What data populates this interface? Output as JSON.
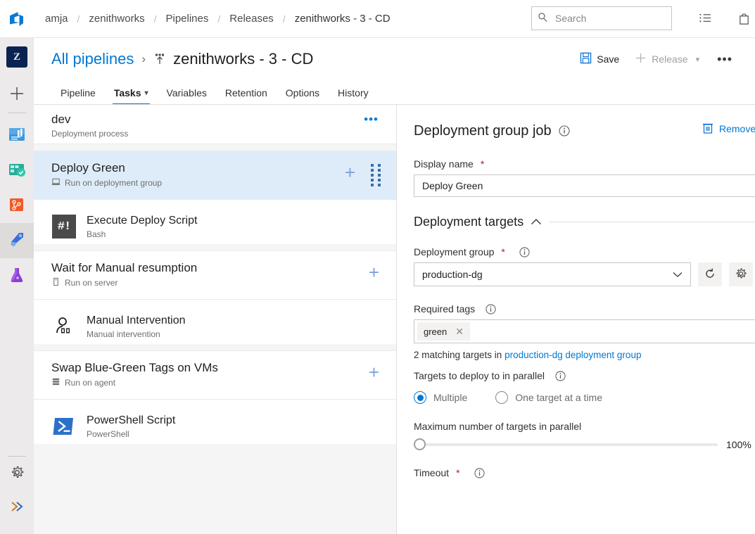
{
  "topbar": {
    "breadcrumb": [
      "amja",
      "zenithworks",
      "Pipelines",
      "Releases",
      "zenithworks - 3 - CD"
    ],
    "separator": "/",
    "search_placeholder": "Search",
    "icons": {
      "search": "search-icon",
      "work_items": "list-icon",
      "marketplace": "shopping-bag-icon"
    }
  },
  "header": {
    "all_pipelines": "All pipelines",
    "chevron": "›",
    "title": "zenithworks - 3 - CD",
    "save_label": "Save",
    "release_label": "Release",
    "ellipsis": "…",
    "tabs": [
      {
        "label": "Pipeline",
        "active": false,
        "has_chevron": false
      },
      {
        "label": "Tasks",
        "active": true,
        "has_chevron": true
      },
      {
        "label": "Variables",
        "active": false,
        "has_chevron": false
      },
      {
        "label": "Retention",
        "active": false,
        "has_chevron": false
      },
      {
        "label": "Options",
        "active": false,
        "has_chevron": false
      },
      {
        "label": "History",
        "active": false,
        "has_chevron": false
      }
    ]
  },
  "tasklist": {
    "process": {
      "title": "dev",
      "subtitle": "Deployment process",
      "ellipsis": "…"
    },
    "groups": [
      {
        "phase": {
          "name": "Deploy Green",
          "sub": "Run on deployment group",
          "selected": true,
          "icon": "deployment-group-icon"
        },
        "tasks": [
          {
            "name": "Execute Deploy Script",
            "sub": "Bash",
            "icon": "bash-icon"
          }
        ]
      },
      {
        "phase": {
          "name": "Wait for Manual resumption",
          "sub": "Run on server",
          "selected": false,
          "icon": "server-icon"
        },
        "tasks": [
          {
            "name": "Manual Intervention",
            "sub": "Manual intervention",
            "icon": "manual-intervention-icon"
          }
        ]
      },
      {
        "phase": {
          "name": "Swap Blue-Green Tags on VMs",
          "sub": "Run on agent",
          "selected": false,
          "icon": "agent-icon"
        },
        "tasks": [
          {
            "name": "PowerShell Script",
            "sub": "PowerShell",
            "icon": "powershell-icon"
          }
        ]
      }
    ]
  },
  "details": {
    "title": "Deployment group job",
    "remove_label": "Remove",
    "display_name": {
      "label": "Display name",
      "required": true,
      "value": "Deploy Green"
    },
    "section": {
      "title": "Deployment targets",
      "collapse_chevron": "⌃"
    },
    "deployment_group": {
      "label": "Deployment group",
      "required": true,
      "value": "production-dg"
    },
    "required_tags": {
      "label": "Required tags",
      "tags": [
        "green"
      ]
    },
    "matching": {
      "prefix": "2 matching targets in ",
      "link": "production-dg deployment group"
    },
    "parallel": {
      "label": "Targets to deploy to in parallel",
      "options": [
        {
          "label": "Multiple",
          "selected": true
        },
        {
          "label": "One target at a time",
          "selected": false
        }
      ]
    },
    "max_parallel": {
      "label": "Maximum number of targets in parallel",
      "value": "100%",
      "percent": 0
    },
    "timeout": {
      "label": "Timeout",
      "required": true
    }
  },
  "rail": {
    "avatar": "Z",
    "plus": "+",
    "items": [
      {
        "name": "overview",
        "label": "Overview"
      },
      {
        "name": "boards",
        "label": "Boards"
      },
      {
        "name": "repos",
        "label": "Repos"
      },
      {
        "name": "pipelines",
        "label": "Pipelines",
        "selected": true
      },
      {
        "name": "test-plans",
        "label": "Test Plans"
      }
    ],
    "settings": "gear-icon",
    "expand": "»"
  },
  "colors": {
    "accent": "#0078d4",
    "selected_row": "#deecf9",
    "required": "#a4262c",
    "rail_bg": "#eceaea"
  }
}
